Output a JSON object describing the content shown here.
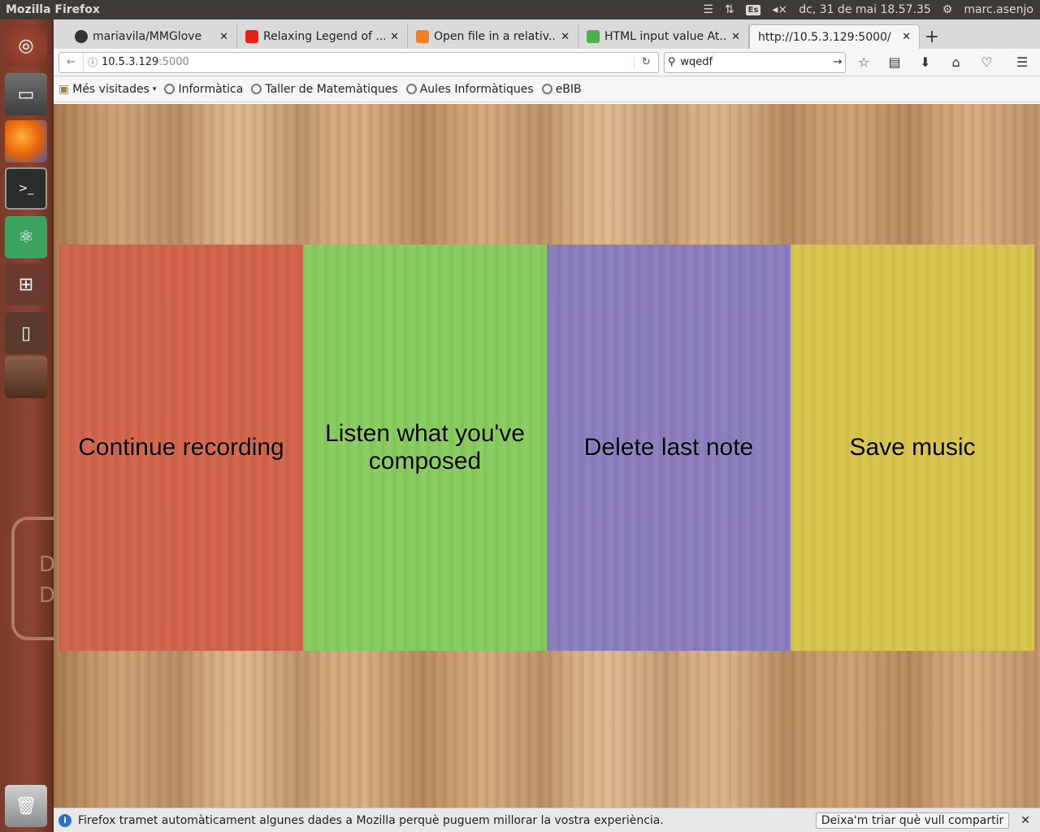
{
  "system": {
    "window_title": "Mozilla Firefox",
    "keyboard_layout": "Es",
    "datetime": "dc, 31 de mai 18.57.35",
    "user": "marc.asenjo"
  },
  "launcher": {
    "partial_label_1": "D",
    "partial_label_2": "D"
  },
  "tabs": [
    {
      "label": "mariavila/MMGlove",
      "icon": "github-icon",
      "color": "#333333"
    },
    {
      "label": "Relaxing Legend of ...",
      "icon": "youtube-icon",
      "color": "#e62117"
    },
    {
      "label": "Open file in a relativ...",
      "icon": "stackoverflow-icon",
      "color": "#f48024"
    },
    {
      "label": "HTML input value At...",
      "icon": "w3schools-icon",
      "color": "#4caf50"
    },
    {
      "label": "http://10.5.3.129:5000/",
      "icon": "",
      "color": ""
    }
  ],
  "navbar": {
    "url_host": "10.5.3.129",
    "url_port": ":5000",
    "search_value": "wqedf"
  },
  "bookmarks": [
    {
      "label": "Més visitades",
      "dropdown": true
    },
    {
      "label": "Informàtica"
    },
    {
      "label": "Taller de Matemàtiques"
    },
    {
      "label": "Aules Informàtiques"
    },
    {
      "label": "eBIB"
    }
  ],
  "panels": [
    {
      "label": "Continue recording",
      "color": "#d2624a"
    },
    {
      "label": "Listen what you've composed",
      "color": "#86cc5c"
    },
    {
      "label": "Delete last note",
      "color": "#8a7dbd"
    },
    {
      "label": "Save music",
      "color": "#d8c44a"
    }
  ],
  "notification": {
    "text": "Firefox tramet automàticament algunes dades a Mozilla perquè puguem millorar la vostra experiència.",
    "button": "Deixa'm triar què vull compartir"
  }
}
